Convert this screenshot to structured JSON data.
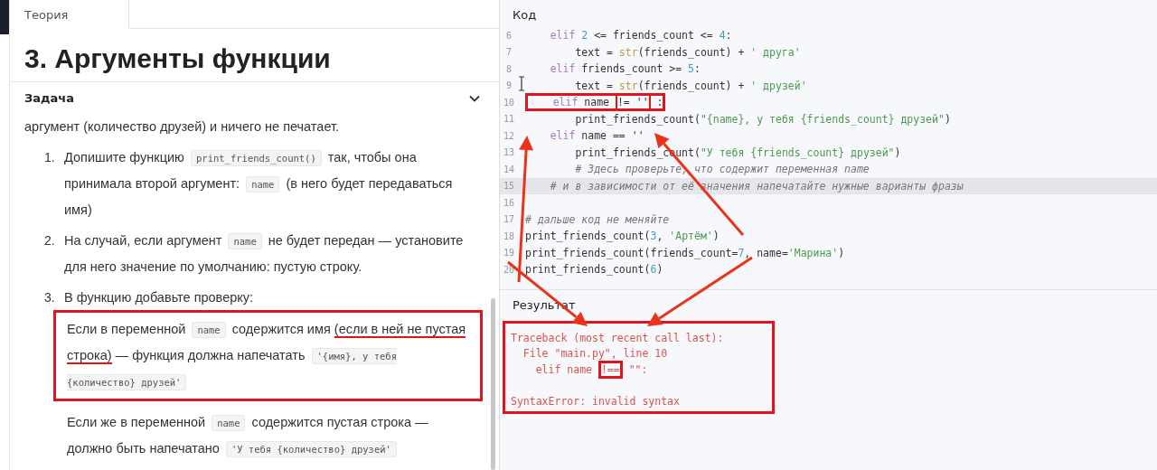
{
  "left_panel": {
    "tabs": [
      {
        "label": "Теория",
        "selected": true
      }
    ],
    "title": "3. Аргументы функции",
    "section": {
      "label": "Задача",
      "expanded": true
    },
    "intro": [
      {
        "kind": "text",
        "t": "аргумент (количество друзей) и ничего не печатает."
      }
    ],
    "steps": [
      {
        "number": "1.",
        "segments": [
          {
            "kind": "text",
            "t": "Допишите функцию "
          },
          {
            "kind": "code",
            "t": "print_friends_count()"
          },
          {
            "kind": "text",
            "t": " так, чтобы она принимала второй аргумент: "
          },
          {
            "kind": "code",
            "t": "name"
          },
          {
            "kind": "text",
            "t": " (в него будет передаваться имя)"
          }
        ]
      },
      {
        "number": "2.",
        "segments": [
          {
            "kind": "text",
            "t": "На случай, если аргумент "
          },
          {
            "kind": "code",
            "t": "name"
          },
          {
            "kind": "text",
            "t": " не будет передан — установите для него значение по умолчанию: пустую строку."
          }
        ]
      },
      {
        "number": "3.",
        "segments": [
          {
            "kind": "text",
            "t": "В функцию добавьте проверку:"
          }
        ],
        "sub": [
          {
            "boxed": true,
            "segments": [
              {
                "kind": "text",
                "t": "Если в переменной "
              },
              {
                "kind": "code",
                "t": "name"
              },
              {
                "kind": "text",
                "t": " содержится имя "
              },
              {
                "kind": "marked",
                "t": "(если в ней не пустая строка)"
              },
              {
                "kind": "text",
                "t": " — функция должна напечатать "
              },
              {
                "kind": "code",
                "t": "'{имя}, у тебя {количество} друзей'"
              }
            ]
          },
          {
            "boxed": false,
            "segments": [
              {
                "kind": "text",
                "t": "Если же в переменной "
              },
              {
                "kind": "code",
                "t": "name"
              },
              {
                "kind": "text",
                "t": " содержится пустая строка — должно быть напечатано "
              },
              {
                "kind": "code",
                "t": "'У тебя {количество} друзей'"
              }
            ]
          }
        ]
      }
    ]
  },
  "code_panel": {
    "title": "Код",
    "lines": [
      {
        "number": "6",
        "selected": false,
        "tokens": [
          {
            "kind": "kw",
            "t": "    elif"
          },
          {
            "kind": "num",
            "t": " 2"
          },
          {
            "kind": "plain",
            "t": " <= friends_count <= "
          },
          {
            "kind": "num",
            "t": "4"
          },
          {
            "kind": "plain",
            "t": ":"
          }
        ]
      },
      {
        "number": "7",
        "selected": false,
        "tokens": [
          {
            "kind": "plain",
            "t": "        text = "
          },
          {
            "kind": "builtin",
            "t": "str"
          },
          {
            "kind": "plain",
            "t": "(friends_count) + "
          },
          {
            "kind": "str",
            "t": "' друга'"
          }
        ]
      },
      {
        "number": "8",
        "selected": false,
        "tokens": [
          {
            "kind": "kw",
            "t": "    elif"
          },
          {
            "kind": "plain",
            "t": " friends_count >= "
          },
          {
            "kind": "num",
            "t": "5"
          },
          {
            "kind": "plain",
            "t": ":"
          }
        ]
      },
      {
        "number": "9",
        "selected": false,
        "tokens": [
          {
            "kind": "plain",
            "t": "        text = "
          },
          {
            "kind": "builtin",
            "t": "str"
          },
          {
            "kind": "plain",
            "t": "(friends_count) + "
          },
          {
            "kind": "str",
            "t": "' друзей'"
          }
        ]
      },
      {
        "number": "10",
        "selected": false,
        "tokens": [
          {
            "kind": "group",
            "boxed": true,
            "tokens": [
              {
                "kind": "kw",
                "t": "    elif"
              },
              {
                "kind": "plain",
                "t": " name "
              },
              {
                "kind": "plain",
                "t": "!= ''",
                "boxed": true
              },
              {
                "kind": "plain",
                "t": " :"
              }
            ]
          }
        ]
      },
      {
        "number": "11",
        "selected": false,
        "tokens": [
          {
            "kind": "plain",
            "t": "        print_friends_count("
          },
          {
            "kind": "str",
            "t": "\"{name}, у тебя {friends_count} друзей\""
          },
          {
            "kind": "plain",
            "t": ")"
          }
        ]
      },
      {
        "number": "12",
        "selected": false,
        "tokens": [
          {
            "kind": "kw",
            "t": "    elif"
          },
          {
            "kind": "plain",
            "t": " name == ''"
          }
        ]
      },
      {
        "number": "13",
        "selected": false,
        "tokens": [
          {
            "kind": "plain",
            "t": "        print_friends_count("
          },
          {
            "kind": "str",
            "t": "\"У тебя {friends_count} друзей\""
          },
          {
            "kind": "plain",
            "t": ")"
          }
        ]
      },
      {
        "number": "14",
        "selected": false,
        "tokens": [
          {
            "kind": "comment",
            "t": "        # Здесь проверьте, что содержит переменная name"
          }
        ]
      },
      {
        "number": "15",
        "selected": true,
        "tokens": [
          {
            "kind": "comment",
            "t": "    # и в зависимости от её значения напечатайте нужные варианты фразы"
          }
        ]
      },
      {
        "number": "16",
        "selected": false
      },
      {
        "number": "17",
        "selected": false,
        "tokens": [
          {
            "kind": "comment",
            "t": "# дальше код не меняйте"
          }
        ]
      },
      {
        "number": "18",
        "selected": false,
        "tokens": [
          {
            "kind": "plain",
            "t": "print_friends_count("
          },
          {
            "kind": "num",
            "t": "3"
          },
          {
            "kind": "plain",
            "t": ", "
          },
          {
            "kind": "str",
            "t": "'Артём'"
          },
          {
            "kind": "plain",
            "t": ")"
          }
        ]
      },
      {
        "number": "19",
        "selected": false,
        "tokens": [
          {
            "kind": "plain",
            "t": "print_friends_count(friends_count="
          },
          {
            "kind": "num",
            "t": "7"
          },
          {
            "kind": "plain",
            "t": ", name="
          },
          {
            "kind": "str",
            "t": "'Марина'"
          },
          {
            "kind": "plain",
            "t": ")"
          }
        ]
      },
      {
        "number": "20",
        "selected": false,
        "tokens": [
          {
            "kind": "plain",
            "t": "print_friends_count("
          },
          {
            "kind": "num",
            "t": "6"
          },
          {
            "kind": "plain",
            "t": ")"
          }
        ]
      }
    ]
  },
  "result_panel": {
    "title": "Результат",
    "boxed": true,
    "lines": [
      {
        "kind": "text",
        "segments": [
          {
            "t": "Traceback (most recent call last):"
          }
        ]
      },
      {
        "kind": "text",
        "segments": [
          {
            "t": "  File \"main.py\", line 10"
          }
        ]
      },
      {
        "kind": "text",
        "segments": [
          {
            "t": "    elif name "
          },
          {
            "t": "!==",
            "boxed": true
          },
          {
            "t": " \"\":"
          }
        ]
      },
      {
        "kind": "blank"
      },
      {
        "kind": "text",
        "segments": [
          {
            "t": "SyntaxError: invalid syntax"
          }
        ]
      }
    ]
  }
}
